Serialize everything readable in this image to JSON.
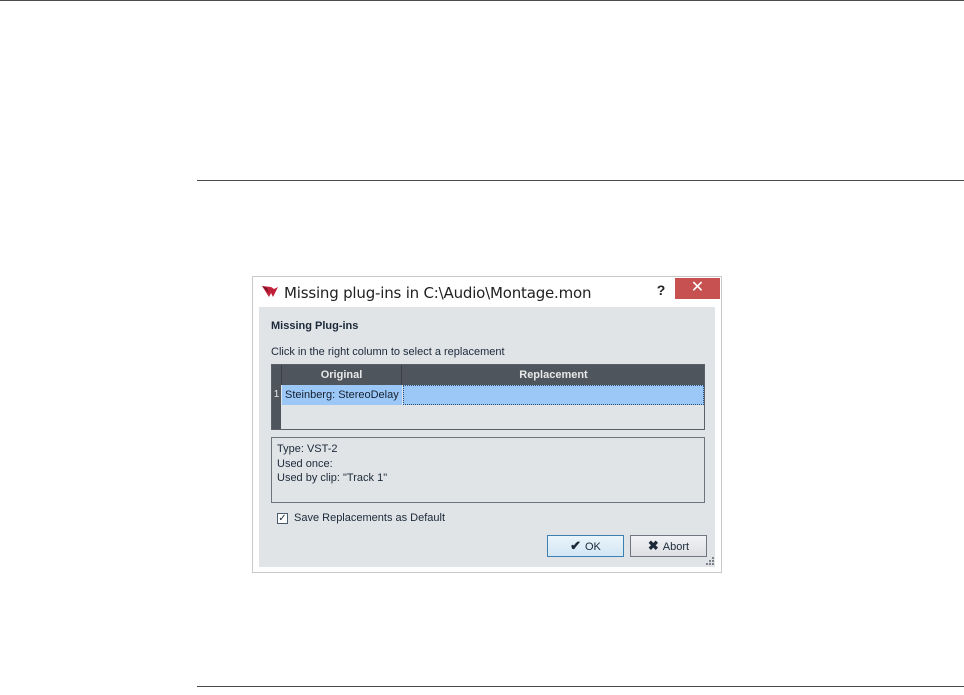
{
  "dialog": {
    "title": "Missing plug-ins in C:\\Audio\\Montage.mon",
    "help_label": "?",
    "close_label": "✕",
    "section_title": "Missing Plug-ins",
    "hint": "Click in the right column to select a replacement",
    "table": {
      "columns": [
        "Original",
        "Replacement"
      ],
      "rows": [
        {
          "index": "1",
          "original": "Steinberg: StereoDelay",
          "replacement": ""
        }
      ]
    },
    "info_lines": [
      "Type: VST-2",
      "Used once:",
      "Used by clip: \"Track 1\""
    ],
    "checkbox": {
      "label": "Save Replacements as Default",
      "checked": true,
      "mark": "✓"
    },
    "buttons": {
      "ok": "OK",
      "ok_icon": "✔",
      "abort": "Abort",
      "abort_icon": "✖"
    }
  },
  "colors": {
    "accent": "#9cc8f8",
    "header": "#4f555c",
    "close": "#c75050",
    "logo": "#c0203a"
  }
}
